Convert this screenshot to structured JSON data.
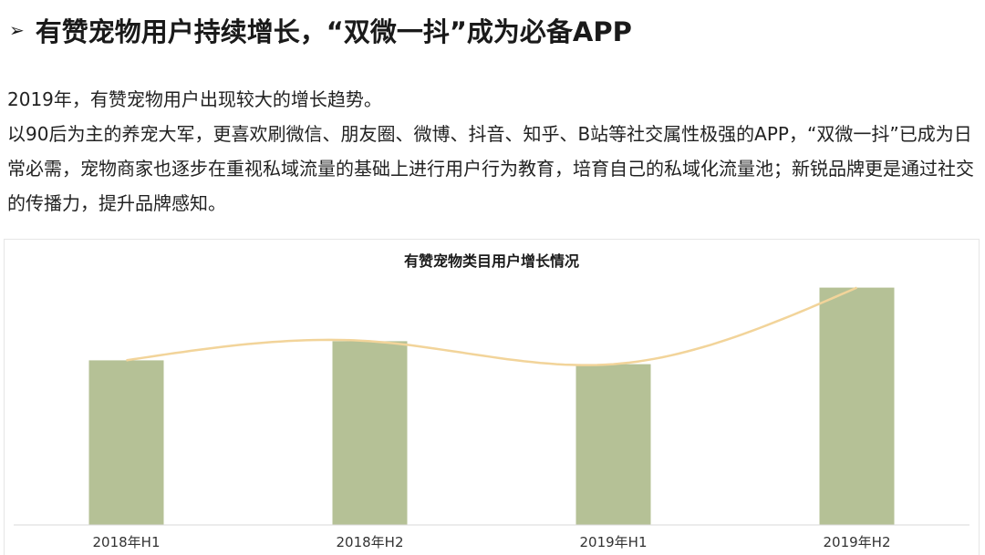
{
  "header": {
    "arrow": "➢",
    "title": "有赞宠物用户持续增长，“双微一抖”成为必备APP"
  },
  "body": {
    "line1": "2019年，有赞宠物用户出现较大的增长趋势。",
    "line2": "以90后为主的养宠大军，更喜欢刷微信、朋友圈、微博、抖音、知乎、B站等社交属性极强的APP，“双微一抖”已成为日常必需，宠物商家也逐步在重视私域流量的基础上进行用户行为教育，培育自己的私域化流量池；新锐品牌更是通过社交的传播力，提升品牌感知。"
  },
  "chart_data": {
    "type": "bar",
    "title": "有赞宠物类目用户增长情况",
    "categories": [
      "2018年H1",
      "2018年H2",
      "2019年H1",
      "2019年H2"
    ],
    "values": [
      43,
      48,
      42,
      62
    ],
    "trendline": true,
    "ylim": [
      0,
      65
    ],
    "grid": false,
    "colors": {
      "bar": "#b5c196",
      "trend": "#f2d49a",
      "axis": "#d9d9d9"
    }
  }
}
